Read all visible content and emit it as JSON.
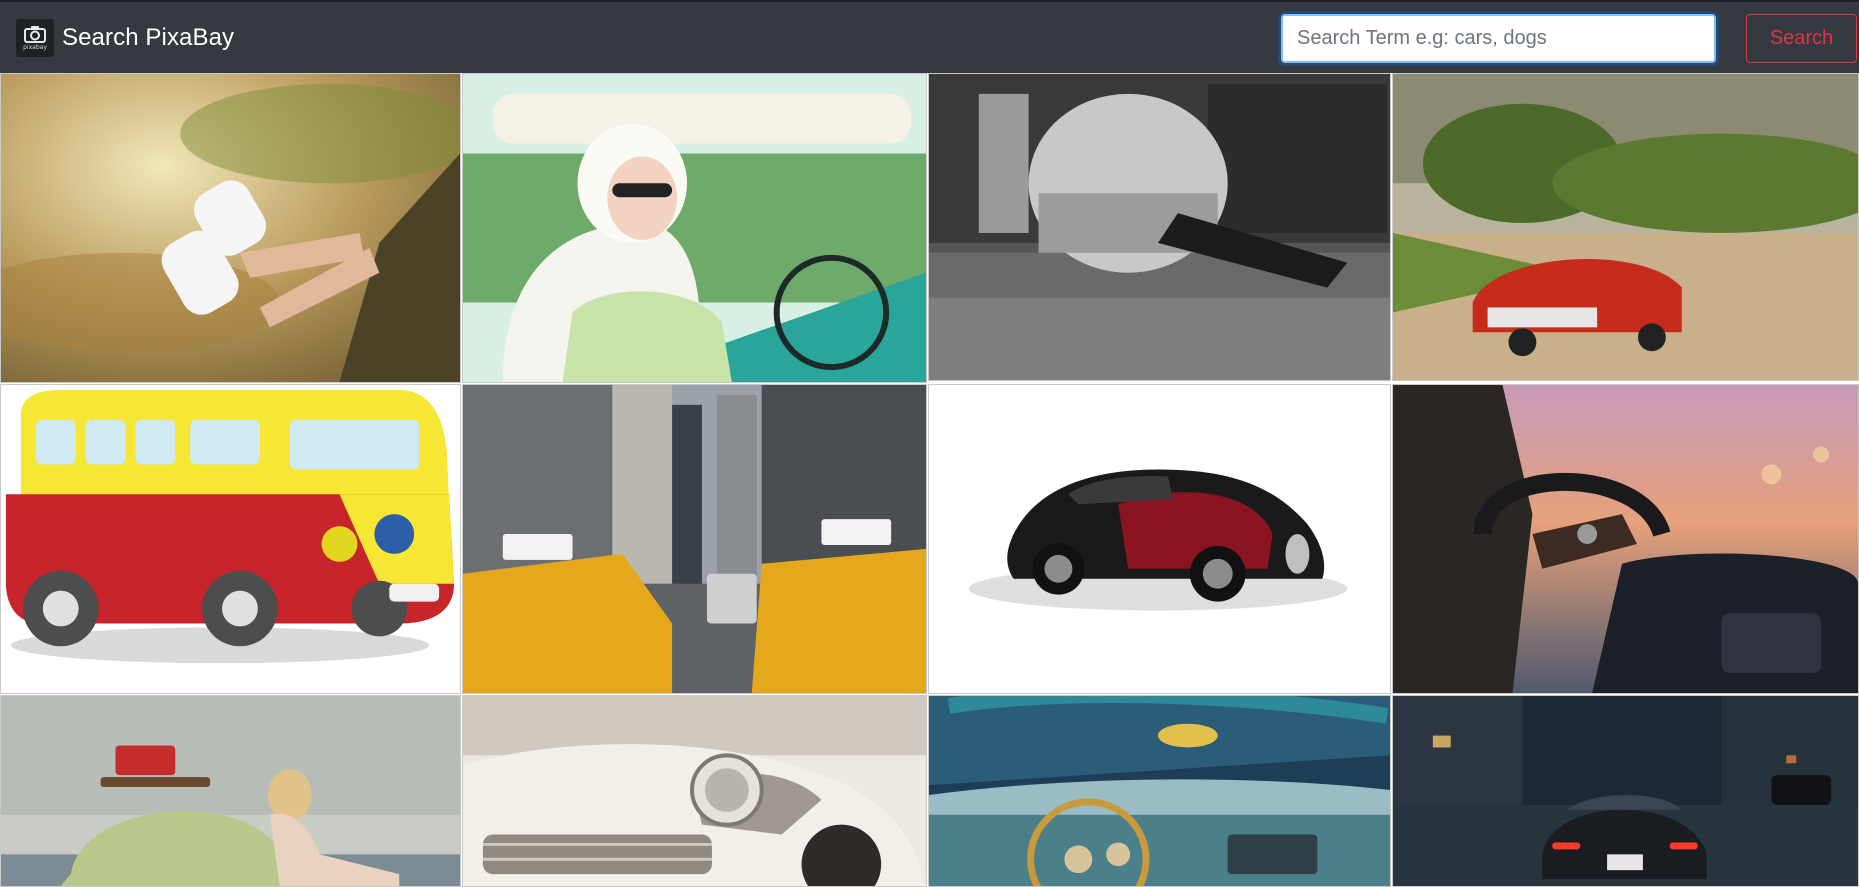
{
  "navbar": {
    "brand_title": "Search PixaBay",
    "logo_text": "pixabay",
    "logo_icon": "camera-icon",
    "bg_color": "#343a40"
  },
  "search": {
    "placeholder": "Search Term e.g: cars, dogs",
    "value": "",
    "button_label": "Search",
    "button_color": "#dc3545",
    "focus_color": "#80bdff"
  },
  "results": [
    {
      "subject": "Legs in white sneakers out of a car window"
    },
    {
      "subject": "Woman with headscarf and sunglasses in a vintage car"
    },
    {
      "subject": "Black and white mechanic under a Beetle"
    },
    {
      "subject": "Red vintage convertible on a dirt road"
    },
    {
      "subject": "Hippie Peace bus illustration"
    },
    {
      "subject": "Yellow taxis on a city street"
    },
    {
      "subject": "Black and red Bugatti supercar"
    },
    {
      "subject": "Driver's hands on a steering wheel"
    },
    {
      "subject": "Woman with a green Beetle at the beach"
    },
    {
      "subject": "White classic Cadillac front"
    },
    {
      "subject": "Vintage car dashboard and steering wheel"
    },
    {
      "subject": "Sports car on a wet city street at night"
    }
  ]
}
